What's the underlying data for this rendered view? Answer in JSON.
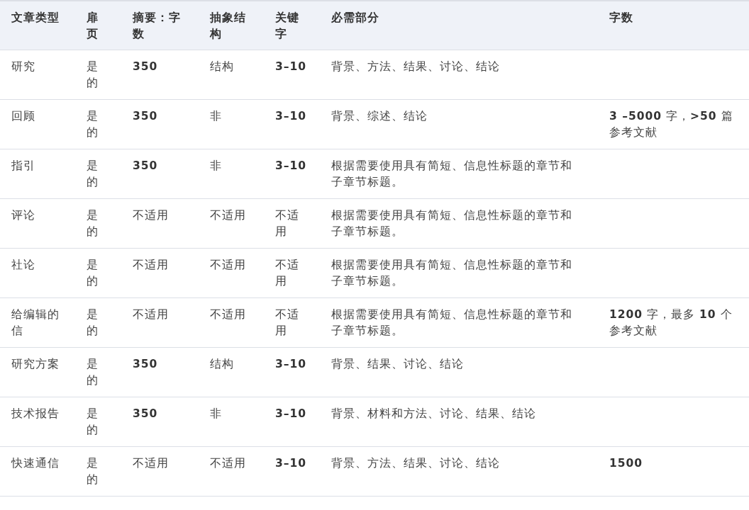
{
  "table": {
    "columns": [
      "文章类型",
      "扉页",
      "摘要：字数",
      "抽象结构",
      "关键字",
      "必需部分",
      "字数"
    ],
    "rows": [
      {
        "cells": [
          {
            "text": "研究",
            "bold": false
          },
          {
            "text": "是的",
            "bold": false
          },
          {
            "text": "350",
            "bold": true
          },
          {
            "text": "结构",
            "bold": false
          },
          {
            "text": "3–10",
            "bold": true
          },
          {
            "text": "背景、方法、结果、讨论、结论",
            "bold": false
          }
        ]
      },
      {
        "cells": [
          {
            "text": "回顾",
            "bold": false
          },
          {
            "text": "是的",
            "bold": false
          },
          {
            "text": "350",
            "bold": true
          },
          {
            "text": "非",
            "bold": false
          },
          {
            "text": "3–10",
            "bold": true
          },
          {
            "text": "背景、综述、结论",
            "bold": false
          },
          {
            "text": "**3 –5000** 字，**>50** 篇参考文献",
            "bold": false
          }
        ]
      },
      {
        "cells": [
          {
            "text": "指引",
            "bold": false
          },
          {
            "text": "是的",
            "bold": false
          },
          {
            "text": "350",
            "bold": true
          },
          {
            "text": "非",
            "bold": false
          },
          {
            "text": "3–10",
            "bold": true
          },
          {
            "text": "根据需要使用具有简短、信息性标题的章节和子章节标题。",
            "bold": false
          }
        ]
      },
      {
        "cells": [
          {
            "text": "评论",
            "bold": false
          },
          {
            "text": "是的",
            "bold": false
          },
          {
            "text": "不适用",
            "bold": false
          },
          {
            "text": "不适用",
            "bold": false
          },
          {
            "text": "不适用",
            "bold": false
          },
          {
            "text": "根据需要使用具有简短、信息性标题的章节和子章节标题。",
            "bold": false
          }
        ]
      },
      {
        "cells": [
          {
            "text": "社论",
            "bold": false
          },
          {
            "text": "是的",
            "bold": false
          },
          {
            "text": "不适用",
            "bold": false
          },
          {
            "text": "不适用",
            "bold": false
          },
          {
            "text": "不适用",
            "bold": false
          },
          {
            "text": "根据需要使用具有简短、信息性标题的章节和子章节标题。",
            "bold": false
          }
        ]
      },
      {
        "cells": [
          {
            "text": "给编辑的信",
            "bold": false
          },
          {
            "text": "是的",
            "bold": false
          },
          {
            "text": "不适用",
            "bold": false
          },
          {
            "text": "不适用",
            "bold": false
          },
          {
            "text": "不适用",
            "bold": false
          },
          {
            "text": "根据需要使用具有简短、信息性标题的章节和子章节标题。",
            "bold": false
          },
          {
            "text": "**1200** 字，最多 **10** 个参考文献",
            "bold": false
          }
        ]
      },
      {
        "cells": [
          {
            "text": "研究方案",
            "bold": false
          },
          {
            "text": "是的",
            "bold": false
          },
          {
            "text": "350",
            "bold": true
          },
          {
            "text": "结构",
            "bold": false
          },
          {
            "text": "3–10",
            "bold": true
          },
          {
            "text": "背景、结果、讨论、结论",
            "bold": false
          }
        ]
      },
      {
        "cells": [
          {
            "text": "技术报告",
            "bold": false
          },
          {
            "text": "是的",
            "bold": false
          },
          {
            "text": "350",
            "bold": true
          },
          {
            "text": "非",
            "bold": false
          },
          {
            "text": "3–10",
            "bold": true
          },
          {
            "text": "背景、材料和方法、讨论、结果、结论",
            "bold": false
          }
        ]
      },
      {
        "cells": [
          {
            "text": "快速通信",
            "bold": false
          },
          {
            "text": "是的",
            "bold": false
          },
          {
            "text": "不适用",
            "bold": false
          },
          {
            "text": "不适用",
            "bold": false
          },
          {
            "text": "3–10",
            "bold": true
          },
          {
            "text": "背景、方法、结果、讨论、结论",
            "bold": false
          },
          {
            "text": "1500",
            "bold": true
          }
        ]
      }
    ]
  }
}
